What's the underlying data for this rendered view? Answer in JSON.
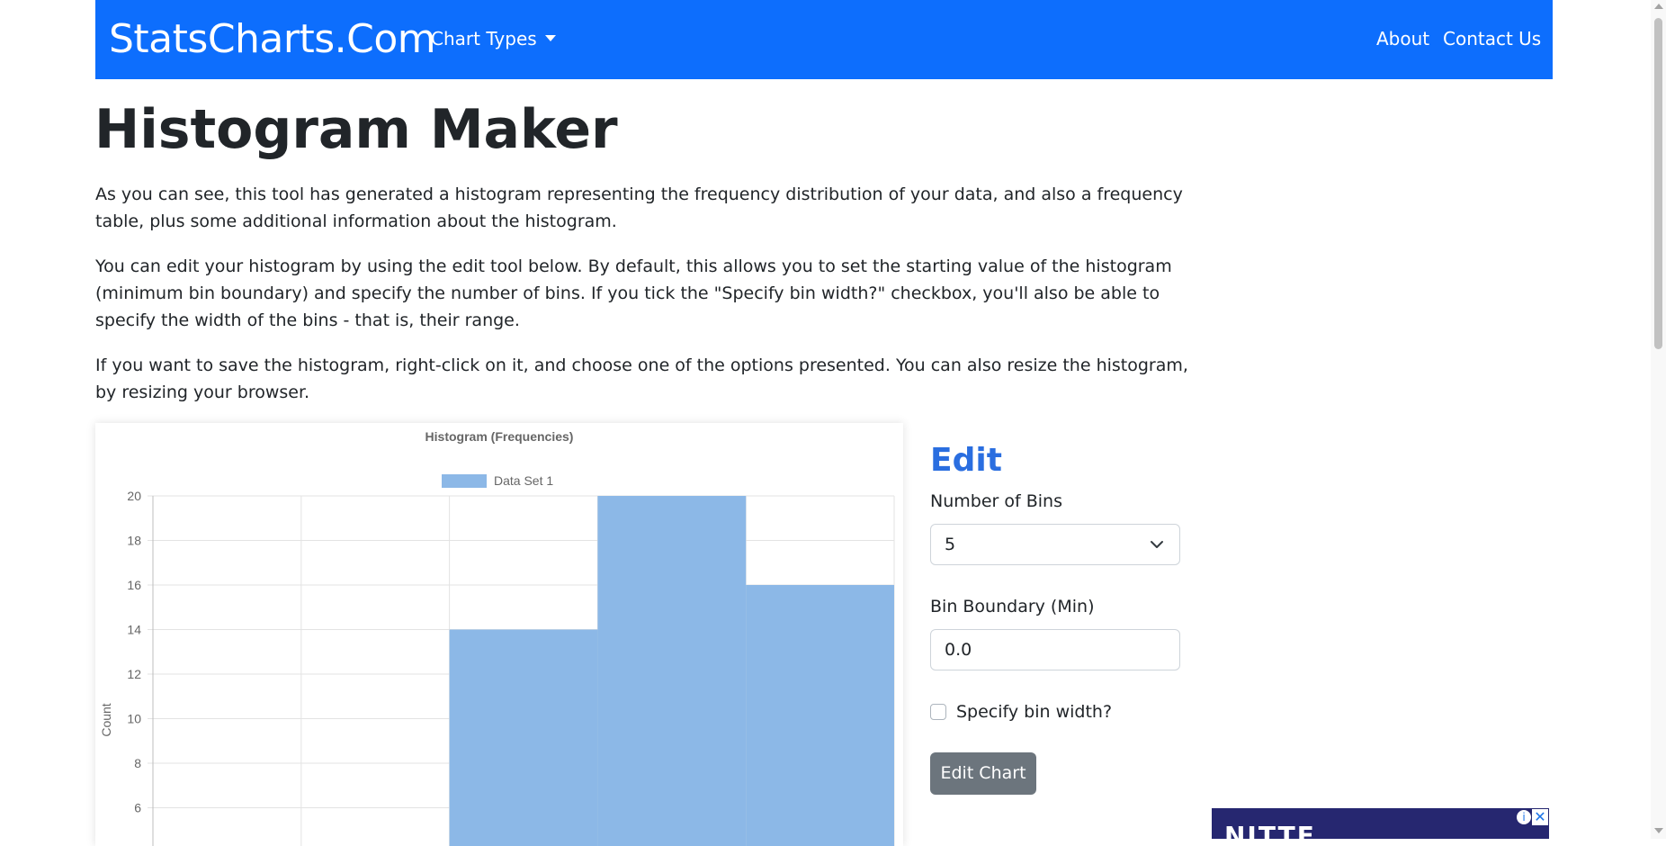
{
  "navbar": {
    "brand": "StatsCharts.Com",
    "dropdown_label": "Chart Types",
    "about": "About",
    "contact": "Contact Us",
    "color": "#0d6efd"
  },
  "page": {
    "title": "Histogram Maker",
    "paragraphs": [
      "As you can see, this tool has generated a histogram representing the frequency distribution of your data, and also a frequency table, plus some additional information about the histogram.",
      "You can edit your histogram by using the edit tool below. By default, this allows you to set the starting value of the histogram (minimum bin boundary) and specify the number of bins. If you tick the \"Specify bin width?\" checkbox, you'll also be able to specify the width of the bins - that is, their range.",
      "If you want to save the histogram, right-click on it, and choose one of the options presented. You can also resize the histogram, by resizing your browser."
    ]
  },
  "edit": {
    "title": "Edit",
    "bins_label": "Number of Bins",
    "bins_value": "5",
    "boundary_label": "Bin Boundary (Min)",
    "boundary_value": "0.0",
    "checkbox_label": "Specify bin width?",
    "checkbox_checked": false,
    "button_label": "Edit Chart"
  },
  "ad": {
    "text": "NITTE",
    "info_icon": "info-icon",
    "close_icon": "close-icon"
  },
  "chart_data": {
    "type": "bar",
    "title": "Histogram (Frequencies)",
    "ylabel": "Count",
    "xlabel": "",
    "series": [
      {
        "name": "Data Set 1",
        "values": [
          0,
          0,
          14,
          20,
          16
        ],
        "color": "#8cb8e7"
      }
    ],
    "bin_count": 5,
    "ylim": [
      0,
      20
    ],
    "y_ticks": [
      6,
      8,
      10,
      12,
      14,
      16,
      18,
      20
    ],
    "visible_y_range": [
      4.6,
      20
    ],
    "grid": true,
    "legend_position": "top"
  }
}
